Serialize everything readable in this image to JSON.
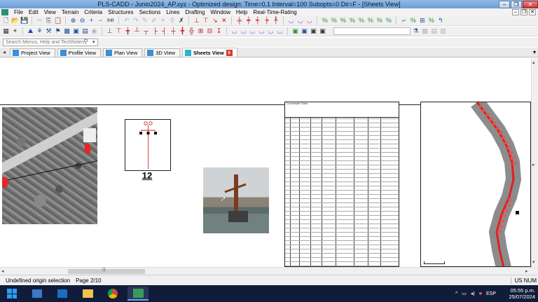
{
  "window": {
    "title": "PLS-CADD - Junio2024_AP.xyz - Optimized design: Time=0.1 Interval=100 Subopts=0 Dir=F - [Sheets View]",
    "controls": [
      "–",
      "❐",
      "✕"
    ]
  },
  "menu": {
    "items": [
      "File",
      "Edit",
      "View",
      "Terrain",
      "Criteria",
      "Structures",
      "Sections",
      "Lines",
      "Drafting",
      "Window",
      "Help",
      "Real-Time-Rating"
    ],
    "mdi_controls": [
      "–",
      "❐",
      "✕"
    ]
  },
  "toolbar": {
    "init_label": "Init"
  },
  "search": {
    "placeholder": "Search Menus, Help and TechNotes"
  },
  "tabs": [
    {
      "label": "Project View",
      "active": false
    },
    {
      "label": "Profile View",
      "active": false
    },
    {
      "label": "Plan View",
      "active": false
    },
    {
      "label": "3D View",
      "active": false
    },
    {
      "label": "Sheets View",
      "active": true
    }
  ],
  "sheet": {
    "structure_number": "12",
    "table_title": "Coordinate Table"
  },
  "status": {
    "message": "Undefined origin selection",
    "page": "Page 2/10",
    "units": "US  NUM"
  },
  "taskbar": {
    "language": "ESP",
    "time": "05:55 p.m.",
    "date": "25/07/2024"
  },
  "colors": {
    "accent": "#c8171e",
    "title_bar": "#8fb9e6",
    "taskbar": "#111c3a"
  }
}
